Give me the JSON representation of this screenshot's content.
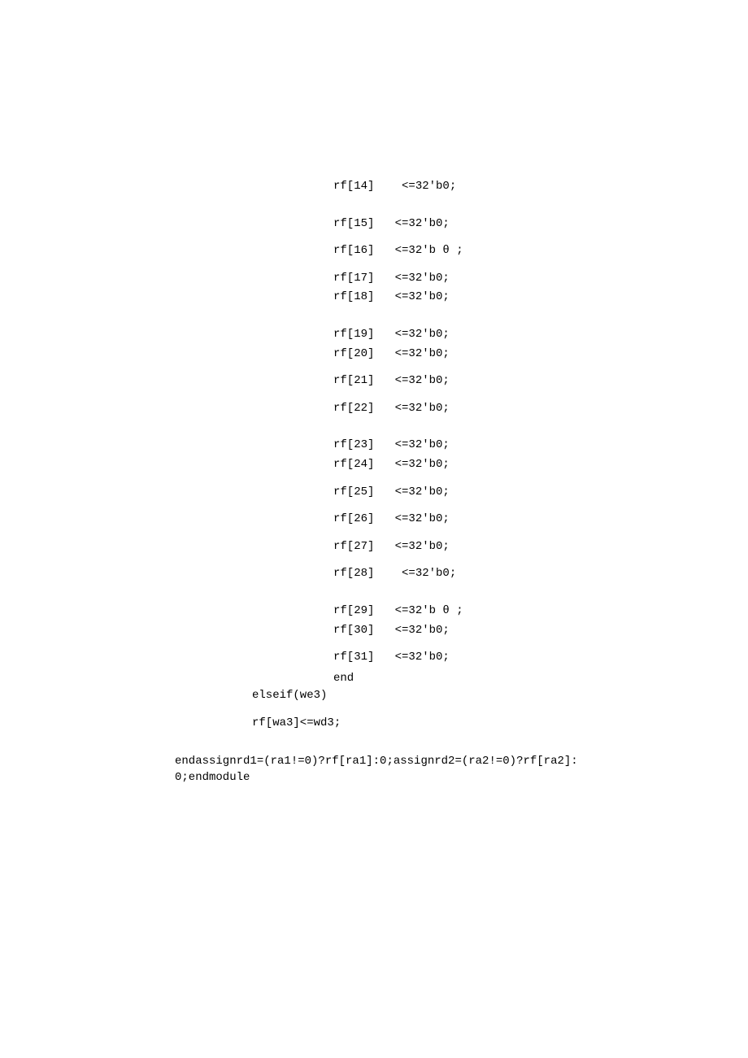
{
  "assignments": [
    {
      "lhs": "rf[14]",
      "op": "  <=",
      "rhs": "32'b0;",
      "gap": "mb-large"
    },
    {
      "lhs": "rf[15]",
      "op": " <=",
      "rhs": "32'b0;",
      "gap": "mb-med"
    },
    {
      "lhs": "rf[16]",
      "op": " <=",
      "rhs": "32'b θ ;",
      "gap": "mb-med"
    },
    {
      "lhs": "rf[17]",
      "op": " <=",
      "rhs": "32'b0;",
      "gap": "mb-small"
    },
    {
      "lhs": "rf[18]",
      "op": " <=",
      "rhs": "32'b0;",
      "gap": "mb-large"
    },
    {
      "lhs": "rf[19]",
      "op": " <=",
      "rhs": "32'b0;",
      "gap": "mb-small"
    },
    {
      "lhs": "rf[20]",
      "op": " <=",
      "rhs": "32'b0;",
      "gap": "mb-med"
    },
    {
      "lhs": "rf[21]",
      "op": " <=",
      "rhs": "32'b0;",
      "gap": "mb-med"
    },
    {
      "lhs": "rf[22]",
      "op": " <=",
      "rhs": "32'b0;",
      "gap": "mb-large"
    },
    {
      "lhs": "rf[23]",
      "op": " <=",
      "rhs": "32'b0;",
      "gap": "mb-small"
    },
    {
      "lhs": "rf[24]",
      "op": " <=",
      "rhs": "32'b0;",
      "gap": "mb-med"
    },
    {
      "lhs": "rf[25]",
      "op": " <=",
      "rhs": "32'b0;",
      "gap": "mb-med"
    },
    {
      "lhs": "rf[26]",
      "op": " <=",
      "rhs": "32'b0;",
      "gap": "mb-med"
    },
    {
      "lhs": "rf[27]",
      "op": " <=",
      "rhs": "32'b0;",
      "gap": "mb-med"
    },
    {
      "lhs": "rf[28]",
      "op": "  <=",
      "rhs": "32'b0;",
      "gap": "mb-large"
    },
    {
      "lhs": "rf[29]",
      "op": " <=",
      "rhs": "32'b θ ;",
      "gap": "mb-small"
    },
    {
      "lhs": "rf[30]",
      "op": " <=",
      "rhs": "32'b0;",
      "gap": "mb-med"
    },
    {
      "lhs": "rf[31]",
      "op": " <=",
      "rhs": "32'b0;",
      "gap": "mb-end"
    }
  ],
  "end_keyword": "end",
  "elseif_line": "elseif(we3)",
  "rfwa_line": "rf[wa3]<=wd3;",
  "bottom_text": "endassignrd1=(ra1!=0)?rf[ra1]:0;assignrd2=(ra2!=0)?rf[ra2]:0;endmodule"
}
